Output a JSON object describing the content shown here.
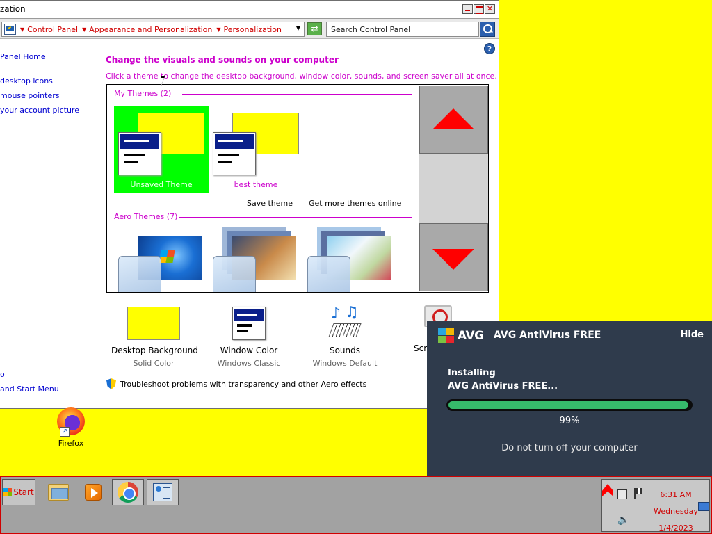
{
  "window": {
    "title": "zation",
    "breadcrumbs": [
      "Control Panel",
      "Appearance and Personalization",
      "Personalization"
    ],
    "search_placeholder": "Search Control Panel",
    "sidebar_links": [
      "Panel Home",
      "desktop icons",
      "mouse pointers",
      "your account picture"
    ],
    "sidebar_bottom": [
      "o",
      "and Start Menu"
    ],
    "heading": "Change the visuals and sounds on your computer",
    "subheading": "Click a theme to change the desktop background, window color, sounds, and screen saver all at once.",
    "my_themes_title": "My Themes (2)",
    "my_themes": [
      {
        "label": "Unsaved Theme",
        "selected": true
      },
      {
        "label": "best theme",
        "selected": false
      }
    ],
    "save_theme": "Save theme",
    "get_more_themes": "Get more themes online",
    "aero_themes_title": "Aero Themes (7)",
    "options": [
      {
        "title": "Desktop Background",
        "subtitle": "Solid Color",
        "icon": "yellow-swatch-icon"
      },
      {
        "title": "Window Color",
        "subtitle": "Windows Classic",
        "icon": "window-color-icon"
      },
      {
        "title": "Sounds",
        "subtitle": "Windows Default",
        "icon": "sounds-icon"
      },
      {
        "title": "Scr",
        "subtitle": "",
        "icon": "screen-saver-icon"
      }
    ],
    "aero_fix_link": "Troubleshoot problems with transparency and other Aero effects",
    "colors": {
      "accent_pink": "#cc00cc",
      "selected_theme": "#00ff00",
      "scroll_arrow": "#ff0000",
      "desktop": "#ffff00"
    }
  },
  "desktop": {
    "icons": [
      {
        "label": "Firefox",
        "icon": "firefox-icon"
      }
    ]
  },
  "avg": {
    "brand": "AVG",
    "product": "AVG AntiVirus FREE",
    "hide_label": "Hide",
    "status_line1": "Installing",
    "status_line2": "AVG AntiVirus FREE...",
    "progress": 0.99,
    "progress_label": "99%",
    "warning": "Do not turn off your computer"
  },
  "taskbar": {
    "start_label": "Start",
    "apps": [
      "file-explorer-icon",
      "media-player-icon",
      "chrome-icon",
      "control-panel-icon"
    ],
    "clock": {
      "time": "6:31 AM",
      "day": "Wednesday",
      "date": "1/4/2023"
    }
  }
}
